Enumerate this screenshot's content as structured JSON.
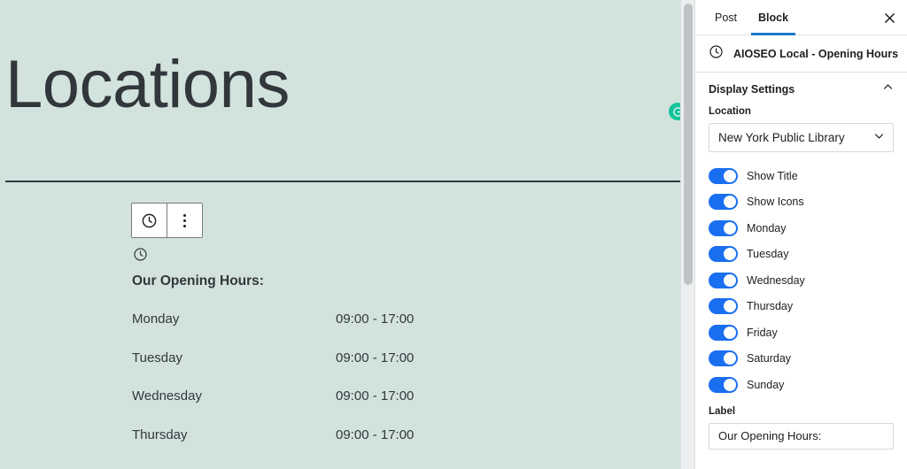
{
  "canvas": {
    "page_title": "Locations",
    "background_color": "#d2e3dd",
    "title_color": "#32373c",
    "grammarly_icon": "grammarly-icon",
    "toolbar": {
      "block_icon": "clock-icon",
      "options_icon": "vertical-dots-icon"
    },
    "block": {
      "icon": "clock-icon",
      "heading": "Our Opening Hours:",
      "rows": [
        {
          "day": "Monday",
          "hours": "09:00 - 17:00"
        },
        {
          "day": "Tuesday",
          "hours": "09:00 - 17:00"
        },
        {
          "day": "Wednesday",
          "hours": "09:00 - 17:00"
        },
        {
          "day": "Thursday",
          "hours": "09:00 - 17:00"
        }
      ]
    }
  },
  "sidebar": {
    "tabs": [
      {
        "label": "Post",
        "active": false
      },
      {
        "label": "Block",
        "active": true
      }
    ],
    "close_icon": "close-icon",
    "active_tab_color": "#1e7ac8",
    "block_info": {
      "icon": "clock-icon",
      "title": "AIOSEO Local - Opening Hours"
    },
    "panel": {
      "title": "Display Settings",
      "collapse_icon": "chevron-up-icon",
      "expanded": true
    },
    "location": {
      "label": "Location",
      "value": "New York Public Library",
      "dropdown_icon": "chevron-down-icon"
    },
    "toggles": [
      {
        "label": "Show Title",
        "on": true
      },
      {
        "label": "Show Icons",
        "on": true
      },
      {
        "label": "Monday",
        "on": true
      },
      {
        "label": "Tuesday",
        "on": true
      },
      {
        "label": "Wednesday",
        "on": true
      },
      {
        "label": "Thursday",
        "on": true
      },
      {
        "label": "Friday",
        "on": true
      },
      {
        "label": "Saturday",
        "on": true
      },
      {
        "label": "Sunday",
        "on": true
      }
    ],
    "toggle_on_color": "#1a6ef0",
    "label_field": {
      "label": "Label",
      "value": "Our Opening Hours:"
    }
  }
}
